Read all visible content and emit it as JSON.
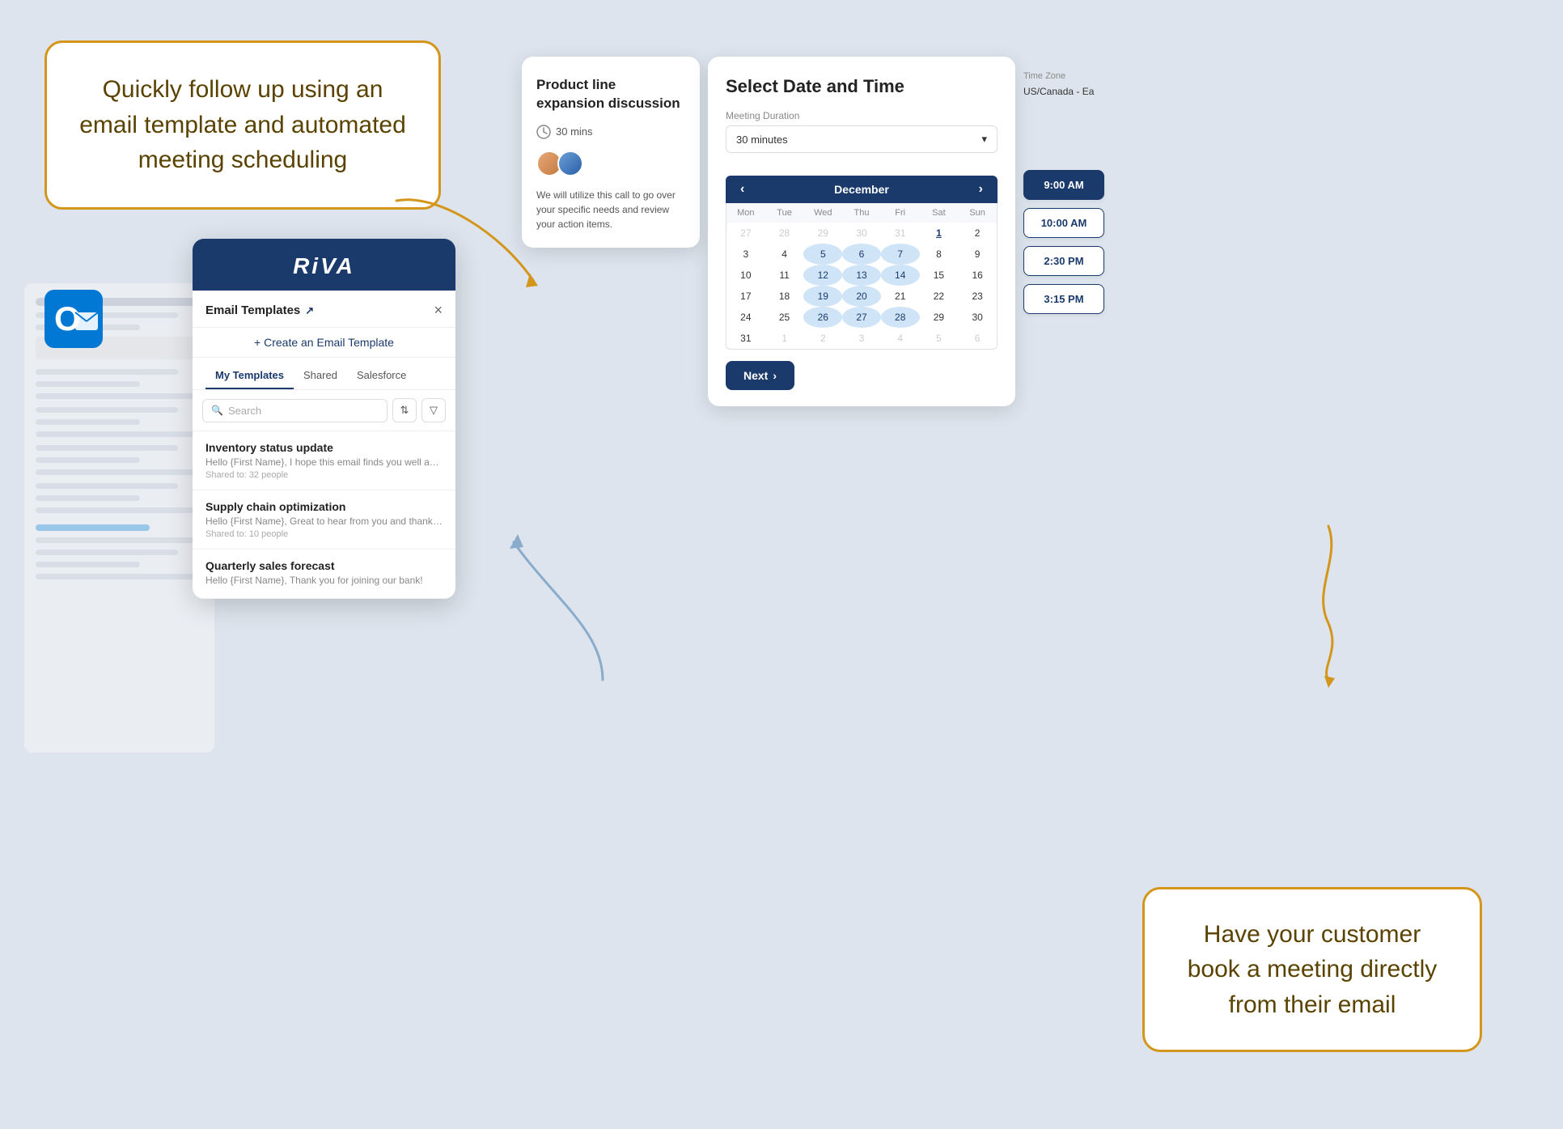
{
  "callout_top": {
    "text": "Quickly follow up using an email template and automated meeting scheduling"
  },
  "callout_bottom": {
    "text": "Have your customer book a meeting directly from their email"
  },
  "riva_panel": {
    "logo": "RiVA",
    "header_title": "Email Templates",
    "close_label": "×",
    "create_label": "+ Create an Email Template",
    "tabs": [
      "My Templates",
      "Shared",
      "Salesforce"
    ],
    "active_tab": "My Templates",
    "search_placeholder": "Search",
    "templates": [
      {
        "title": "Inventory status update",
        "preview": "Hello {First Name}, I hope this email finds you well and th...",
        "shared": "Shared to: 32 people"
      },
      {
        "title": "Supply chain optimization",
        "preview": "Hello {First Name}, Great to hear from you and thanks for...",
        "shared": "Shared to: 10 people"
      },
      {
        "title": "Quarterly sales forecast",
        "preview": "Hello {First Name}, Thank you for joining our bank!"
      }
    ]
  },
  "meeting_panel": {
    "title": "Product line expansion discussion",
    "duration": "30 mins",
    "description": "We will utilize this call to go over your specific needs and review your action items."
  },
  "datetime_panel": {
    "title": "Select Date and Time",
    "duration_label": "Meeting Duration",
    "duration_value": "30 minutes",
    "timezone_label": "Time Zone",
    "timezone_value": "US/Canada - Ea",
    "month": "December",
    "day_headers": [
      "Mon",
      "Tue",
      "Wed",
      "Thu",
      "Fri",
      "Sat",
      "Sun"
    ],
    "weeks": [
      [
        "27",
        "28",
        "29",
        "30",
        "31",
        "1",
        "2"
      ],
      [
        "3",
        "4",
        "5",
        "6",
        "7",
        "8",
        "9"
      ],
      [
        "10",
        "11",
        "12",
        "13",
        "14",
        "15",
        "16"
      ],
      [
        "17",
        "18",
        "19",
        "20",
        "21",
        "22",
        "23"
      ],
      [
        "24",
        "25",
        "26",
        "27",
        "28",
        "29",
        "30"
      ],
      [
        "31",
        "1",
        "2",
        "3",
        "4",
        "5",
        "6"
      ]
    ],
    "highlighted_dates": [
      "5",
      "6",
      "7",
      "12",
      "13",
      "14",
      "19",
      "20",
      "26",
      "27",
      "28"
    ],
    "selected_date": "21",
    "blue_link_date": "1",
    "next_label": "Next"
  },
  "timeslots": {
    "label": "Time Zone",
    "timezone": "US/Canada - Ea",
    "slots": [
      "9:00 AM",
      "10:00 AM",
      "2:30 PM",
      "3:15 PM"
    ],
    "selected_slot": "9:00 AM"
  }
}
